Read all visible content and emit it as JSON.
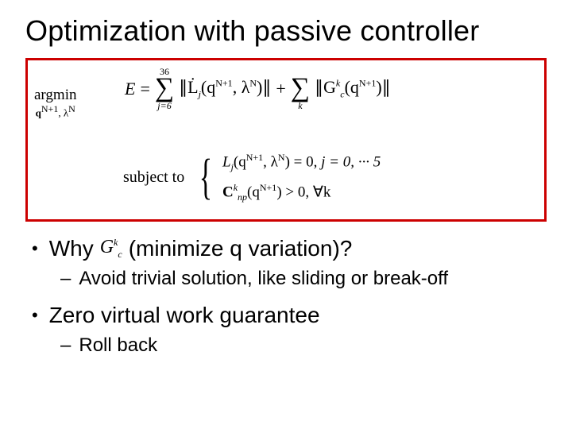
{
  "slide": {
    "title": "Optimization with passive controller",
    "math": {
      "argmin_label": "argmin",
      "argmin_sub": "q",
      "argmin_sup1": "N+1",
      "argmin_lambda": ", λ",
      "argmin_sup2": "N",
      "E": "E",
      "eq": "=",
      "sum1_top": "36",
      "sum1_bot": "j=6",
      "term1_a": "∥L̇",
      "term1_sub": "j",
      "term1_b": "(q",
      "term1_sup1": "N+1",
      "term1_c": ", λ",
      "term1_sup2": "N",
      "term1_d": ")∥",
      "plus": "+",
      "sum2_bot": "k",
      "term2_a": "∥G",
      "term2_sub": "c",
      "term2_sup": "k",
      "term2_b": "(q",
      "term2_sup2": "N+1",
      "term2_c": ")∥",
      "subject_to": "subject to",
      "case1_a": "L",
      "case1_sub": "j",
      "case1_b": "(q",
      "case1_sup1": "N+1",
      "case1_c": ", λ",
      "case1_sup2": "N",
      "case1_d": ") = 0,",
      "case1_e": "  j = 0, ··· 5",
      "case2_a": "C",
      "case2_sub": "np",
      "case2_sup": "k",
      "case2_b": "(q",
      "case2_sup2": "N+1",
      "case2_c": ") > 0,",
      "case2_d": "  ∀k"
    },
    "bullets": {
      "b1_a": "Why",
      "b1_math_a": "G",
      "b1_math_sup": "k",
      "b1_math_sub": "c",
      "b1_b": "(minimize q variation)?",
      "b1_sub1": "Avoid trivial solution, like sliding or break-off",
      "b2": "Zero virtual work guarantee",
      "b2_sub1": "Roll back"
    }
  }
}
